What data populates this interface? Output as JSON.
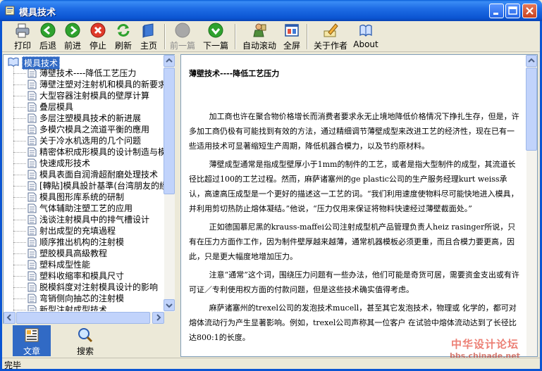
{
  "window": {
    "title": "模具技术"
  },
  "toolbar": {
    "print": "打印",
    "back": "后退",
    "forward": "前进",
    "stop": "停止",
    "refresh": "刷新",
    "home": "主页",
    "prev": "前一篇",
    "next": "下一篇",
    "autoscroll": "自动滚动",
    "fullscreen": "全屏",
    "about_author": "关于作者",
    "about": "About"
  },
  "tree": {
    "root": "模具技术",
    "items": [
      "薄壁技术----降低工艺压力",
      "薄壁注塑对注射机和模具的新要求",
      "大型容器注射模具的壁厚计算",
      "叠层模具",
      "多层注塑模具技术的新进展",
      "多模穴模具之流道平衡的應用",
      "关于冷水机选用的几个问题",
      "精密体积成形模具的设计制造与模",
      "快速成形技术",
      "模具表面自润滑超耐磨处理技术",
      "[轉貼]模具設計基準(台湾朋友的經",
      "模具图形库系统的研制",
      "气体辅助注塑工艺的应用",
      "浅谈注射模具中的排气槽设计",
      "射出成型的充填過程",
      "顺序推出机构的注射模",
      "塑胶模具高級教程",
      "塑料成型性能",
      "塑料收缩率和模具尺寸",
      "脱模斜度对注射模具设计的影响",
      "弯销侧向抽芯的注射模",
      "新型注射成型技术"
    ]
  },
  "tabs": {
    "article": "文章",
    "search": "搜索"
  },
  "article": {
    "title": "薄壁技术----降低工艺压力",
    "paragraphs": [
      "加工商也许在聚合物价格增长而消费者要求永无止境地降低价格情况下挣扎生存，但是，许多加工商仍极有可能找到有效的方法，通过精细调节薄壁成型来改进工艺的经济性，现在已有一些适用技术可显著缩短生产周期，降低机器合模力，以及节约原材料。",
      "薄壁成型通常是指成型壁厚小于1mm的制件的工艺，或者是指大型制件的成型，其流道长径比超过100的工艺过程。然而，麻萨诸塞州的ge plastic公司的生产服务经理kurt weiss承认，高速高压成型是一个更好的描述这一工艺的词。“我们利用速度使物料尽可能快地进入模具，并利用剪切热防止熔体凝结。”他说，“压力仅用来保证将物料快速经过薄壁截面处。”",
      "正如德国慕尼黑的krauss-maffei公司注射成型机产品管理负责人heiz rasinger所说，只有在压力方面作工作，因为制件壁厚越来越薄，通常机器模板必须更重，而且合模力要更高，因此，只是更大幅度地增加压力。",
      "注意“通常”这个词，围绕压力问题有一些办法，他们可能是奇货可居，需要资金支出或有许可证／专利使用权方面的付款问题，但是这些技术确实值得考虑。",
      "麻萨诸塞州的trexel公司的发泡技术mucell，甚至其它发泡技术，物理或 化学的，都可对熔体流动行为产生显著影响。例如，trexel公司声称其一位客户 在试验中熔体流动达到了长径比达800:1的长度。"
    ]
  },
  "watermark": {
    "line1": "中华设计论坛",
    "line2": "bbs.chinade.net"
  },
  "status": {
    "text": "完毕"
  },
  "colors": {
    "titlebar": "#0b55d2",
    "selection": "#316ac5",
    "window_bg": "#ece9d8"
  }
}
